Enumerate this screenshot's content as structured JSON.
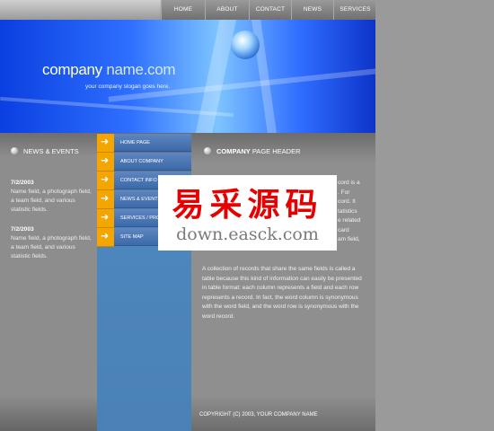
{
  "nav": {
    "items": [
      "HOME",
      "ABOUT",
      "CONTACT",
      "NEWS",
      "SERVICES"
    ]
  },
  "hero": {
    "title_bold": "company",
    "title_rest": " name.com",
    "slogan": "your company slogan goes here."
  },
  "news": {
    "header": "NEWS & EVENTS",
    "items": [
      {
        "date": "7/2/2003",
        "text": "Name field, a photograph field, a team field, and various statistic fields."
      },
      {
        "date": "7/2/2003",
        "text": "Name field, a photograph field, a team field, and various statistic fields."
      }
    ]
  },
  "menu": {
    "items": [
      "HOME PAGE",
      "ABOUT COMPANY",
      "CONTACT INFO",
      "NEWS & EVENTS",
      "SERVICES / PRO",
      "SITE MAP"
    ]
  },
  "content": {
    "header_bold": "COMPANY",
    "header_rest": " PAGE HEADER",
    "para1_fragments": [
      "cord is a",
      ". For",
      "cord. It",
      "tatistics",
      "e related",
      "card",
      "am field,"
    ],
    "para2": "A collection of records that share the same fields is called a table because this kind of information can easily be presented in table format: each column represents a field and each row represents a record. In fact, the word column is synonymous with the word field, and the word row is synonymous with the word record."
  },
  "footer": {
    "copyright": "COPYRIGHT (C) 2003, YOUR COMPANY NAME"
  },
  "watermark": {
    "cn": "易采源码",
    "url": "down.easck.com"
  },
  "colors": {
    "accent_orange": "#f4a500",
    "menu_blue": "#3b6aa9",
    "hero_blue": "#2f70ff",
    "watermark_red": "#e60000"
  }
}
